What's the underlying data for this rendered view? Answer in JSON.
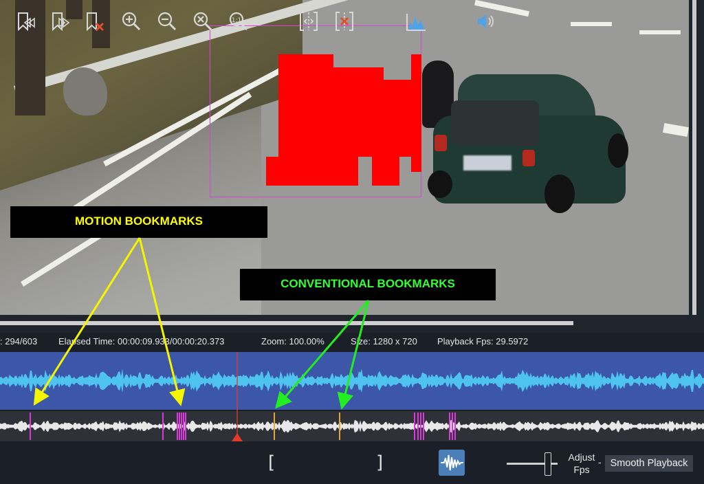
{
  "info": {
    "frame": ": 294/603",
    "elapsed": "Elapsed Time: 00:00:09.933/00:00:20.373",
    "zoom": "Zoom: 100.00%",
    "size": "Size: 1280 x 720",
    "fps": "Playback Fps: 29.5972"
  },
  "callouts": {
    "motion": "MOTION BOOKMARKS",
    "conventional": "CONVENTIONAL BOOKMARKS"
  },
  "colors": {
    "motion_bookmark": "#d93ad9",
    "conventional_bookmark": "#e8a33a",
    "playhead": "#e23b2a",
    "waveform_top": "#4fc3ef",
    "waveform_bottom": "#e8e8e8",
    "motion_label": "#ffff00",
    "conventional_label": "#33ff33",
    "arrow_yellow": "#f5f500",
    "arrow_green": "#22ee22"
  },
  "toolbar": {
    "icons": [
      "add-bookmark-icon",
      "next-bookmark-icon",
      "delete-bookmark-icon",
      "zoom-in-icon",
      "zoom-out-icon",
      "zoom-fit-icon",
      "zoom-1to1-icon",
      "mark-in-icon",
      "split-icon",
      "cut-icon",
      "mark-out-icon",
      "histogram-icon",
      "waveform-icon",
      "volume-icon"
    ],
    "mark_in": "[",
    "mark_out": "]",
    "adjust_line1": "Adjust",
    "adjust_line2": "Fps",
    "dash": "-",
    "smooth_playback": "Smooth Playback"
  }
}
